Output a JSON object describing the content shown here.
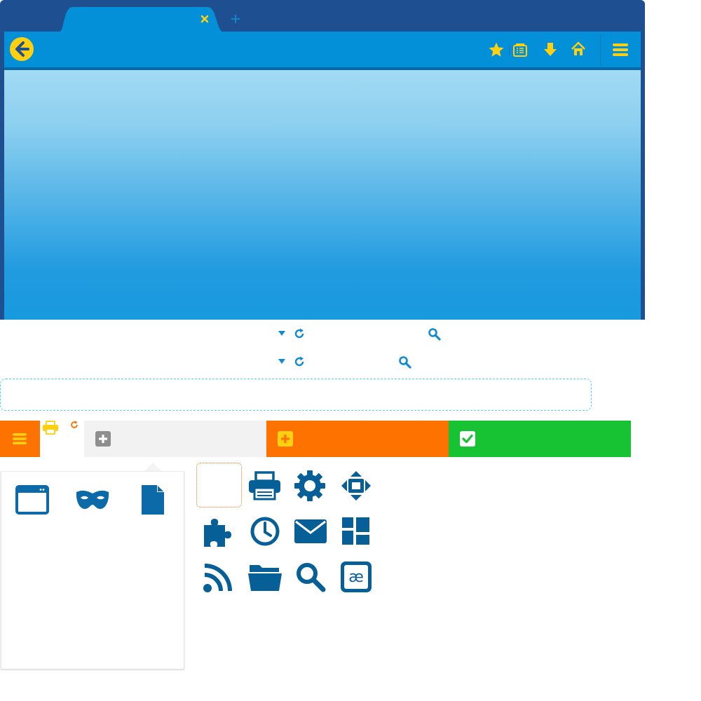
{
  "colors": {
    "frame": "#1e4f91",
    "tab_active": "#0390d9",
    "nav_bar": "#0390d9",
    "icon_yellow": "#ffd00f",
    "icon_blue": "#0b6aa7",
    "icon_dark_blue": "#075f97",
    "content_gradient_top": "#a2daf3",
    "content_gradient_bottom": "#189ade",
    "orange": "#fe7300",
    "green": "#18c333",
    "gray_tab": "#f2f2f2",
    "selection_dotted": "#f07d1f",
    "urlbar_dashed": "#4fd8ea"
  },
  "titlebar": {
    "tab": {
      "close_icon": "close-icon"
    },
    "new_tab_icon": "plus-icon"
  },
  "navbar": {
    "back_icon": "back-arrow-icon",
    "right_icons": [
      "star-icon",
      "reading-list-icon",
      "download-icon",
      "home-icon"
    ],
    "menu_icon": "hamburger-menu-icon"
  },
  "toolbar_rows": [
    {
      "dropdown_icon": "dropdown-triangle-icon",
      "reload_icon": "reload-icon",
      "search_icon": "search-icon"
    },
    {
      "dropdown_icon": "dropdown-triangle-icon",
      "reload_icon": "reload-icon",
      "search_icon": "search-icon"
    }
  ],
  "bottom_bar": {
    "menu_icon": "hamburger-menu-icon",
    "print_icon": "print-icon",
    "reload_icon": "reload-icon",
    "tabs": [
      {
        "icon": "plus-square-icon",
        "style": "gray"
      },
      {
        "icon": "plus-square-icon",
        "style": "orange"
      },
      {
        "icon": "check-square-icon",
        "style": "green"
      }
    ]
  },
  "panel": {
    "items": [
      "new-window-icon",
      "private-browsing-mask-icon",
      "new-file-icon"
    ]
  },
  "icon_grid": [
    [
      "empty-slot",
      "print-icon",
      "gear-icon",
      "fullscreen-icon"
    ],
    [
      "puzzle-addon-icon",
      "clock-history-icon",
      "mail-icon",
      "layout-dashboard-icon"
    ],
    [
      "rss-feed-icon",
      "folder-open-icon",
      "search-icon",
      "character-encoding-icon"
    ]
  ],
  "icon_grid_glyphs": {
    "character-encoding-icon": "æ"
  }
}
